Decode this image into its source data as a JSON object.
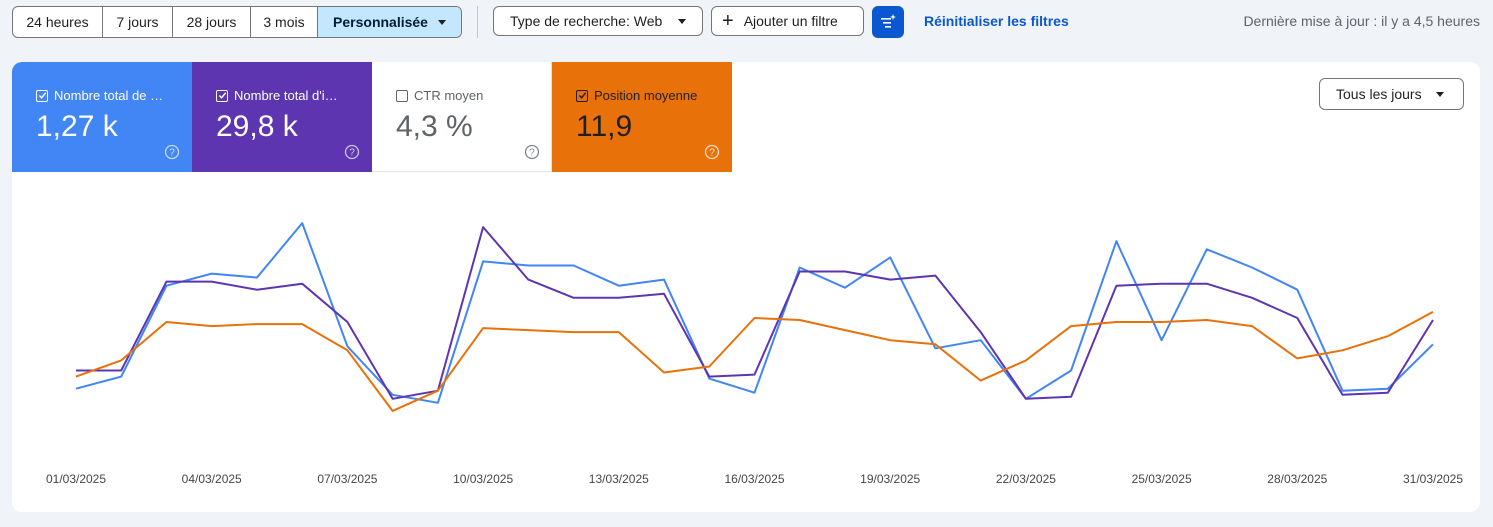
{
  "toolbar": {
    "date_ranges": [
      "24 heures",
      "7 jours",
      "28 jours",
      "3 mois"
    ],
    "custom_range": "Personnalisée",
    "search_type": "Type de recherche: Web",
    "add_filter": "Ajouter un filtre",
    "reset_filters": "Réinitialiser les filtres",
    "last_update": "Dernière mise à jour : il y a 4,5 heures"
  },
  "metrics": {
    "clicks": {
      "label": "Nombre total de clics",
      "value": "1,27 k",
      "checked": true,
      "color": "#4285f4"
    },
    "impressions": {
      "label": "Nombre total d'impressions",
      "value": "29,8 k",
      "checked": true,
      "color": "#5e35b1"
    },
    "ctr": {
      "label": "CTR moyen",
      "value": "4,3 %",
      "checked": false
    },
    "position": {
      "label": "Position moyenne",
      "value": "11,9",
      "checked": true,
      "color": "#e8710a"
    }
  },
  "range_select": "Tous les jours",
  "chart_data": {
    "type": "line",
    "x": [
      "01/03/2025",
      "02/03/2025",
      "03/03/2025",
      "04/03/2025",
      "05/03/2025",
      "06/03/2025",
      "07/03/2025",
      "08/03/2025",
      "09/03/2025",
      "10/03/2025",
      "11/03/2025",
      "12/03/2025",
      "13/03/2025",
      "14/03/2025",
      "15/03/2025",
      "16/03/2025",
      "17/03/2025",
      "18/03/2025",
      "19/03/2025",
      "20/03/2025",
      "21/03/2025",
      "22/03/2025",
      "23/03/2025",
      "24/03/2025",
      "25/03/2025",
      "26/03/2025",
      "27/03/2025",
      "28/03/2025",
      "29/03/2025",
      "30/03/2025",
      "31/03/2025"
    ],
    "x_tick_labels": [
      "01/03/2025",
      "04/03/2025",
      "07/03/2025",
      "10/03/2025",
      "13/03/2025",
      "16/03/2025",
      "19/03/2025",
      "22/03/2025",
      "25/03/2025",
      "28/03/2025",
      "31/03/2025"
    ],
    "series": [
      {
        "name": "Nombre total de clics",
        "color": "#4285f4",
        "values": [
          0.15,
          0.21,
          0.66,
          0.72,
          0.7,
          0.97,
          0.36,
          0.12,
          0.08,
          0.78,
          0.76,
          0.76,
          0.66,
          0.69,
          0.2,
          0.13,
          0.75,
          0.65,
          0.8,
          0.35,
          0.39,
          0.1,
          0.24,
          0.88,
          0.39,
          0.84,
          0.75,
          0.64,
          0.14,
          0.15,
          0.37
        ]
      },
      {
        "name": "Nombre total d'impressions",
        "color": "#5e35b1",
        "values": [
          0.24,
          0.24,
          0.68,
          0.68,
          0.64,
          0.67,
          0.48,
          0.1,
          0.14,
          0.95,
          0.69,
          0.6,
          0.6,
          0.62,
          0.21,
          0.22,
          0.73,
          0.73,
          0.69,
          0.71,
          0.43,
          0.1,
          0.11,
          0.66,
          0.67,
          0.67,
          0.6,
          0.5,
          0.12,
          0.13,
          0.49
        ]
      },
      {
        "name": "Position moyenne",
        "color": "#e8710a",
        "values": [
          0.21,
          0.29,
          0.48,
          0.46,
          0.47,
          0.47,
          0.34,
          0.04,
          0.14,
          0.45,
          0.44,
          0.43,
          0.43,
          0.23,
          0.26,
          0.5,
          0.49,
          0.44,
          0.39,
          0.37,
          0.19,
          0.29,
          0.46,
          0.48,
          0.48,
          0.49,
          0.46,
          0.3,
          0.34,
          0.41,
          0.53
        ]
      }
    ]
  }
}
